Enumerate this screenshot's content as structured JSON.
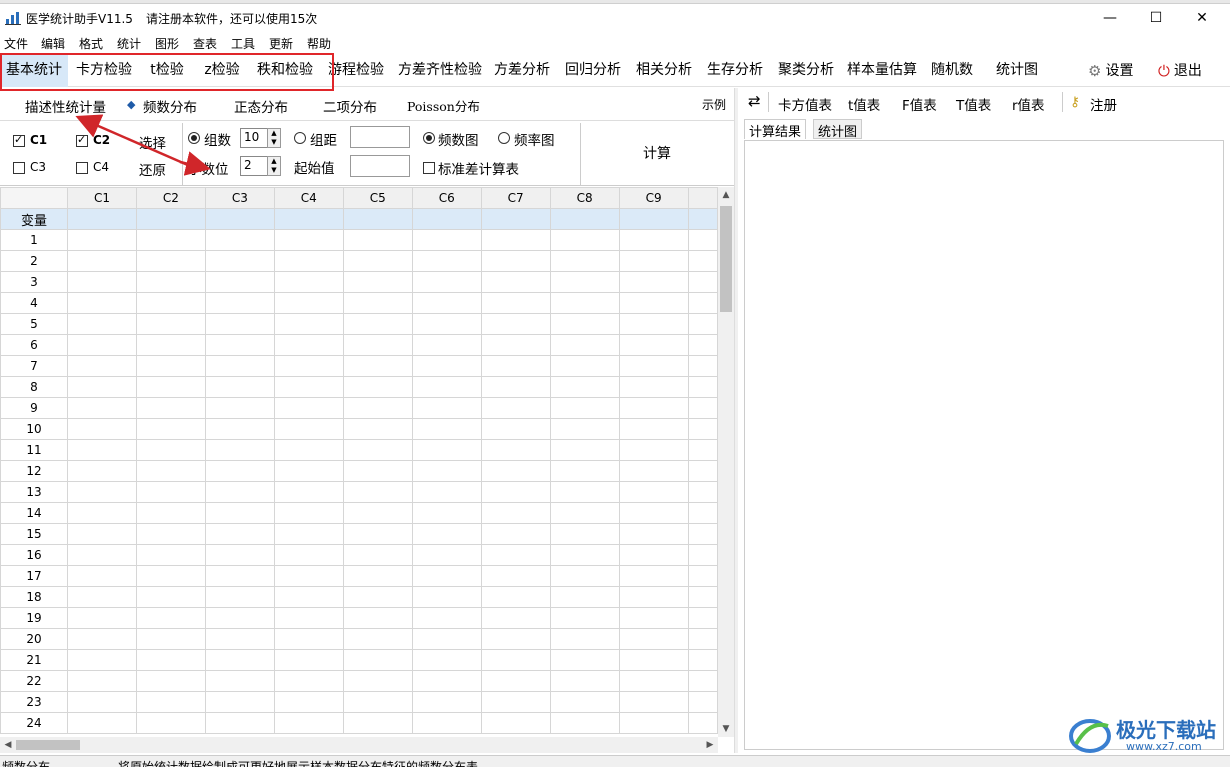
{
  "window": {
    "title": "医学统计助手V11.5",
    "notice": "请注册本软件，还可以使用15次",
    "controls": {
      "minimize": "—",
      "maximize": "☐",
      "close": "✕"
    }
  },
  "menu": [
    "文件",
    "编辑",
    "格式",
    "统计",
    "图形",
    "查表",
    "工具",
    "更新",
    "帮助"
  ],
  "toolbar": {
    "tabs": [
      "基本统计",
      "卡方检验",
      "t检验",
      "z检验",
      "秩和检验",
      "游程检验",
      "方差齐性检验",
      "方差分析",
      "回归分析",
      "相关分析",
      "生存分析",
      "聚类分析",
      "样本量估算",
      "随机数",
      "统计图"
    ],
    "active": "基本统计",
    "settings": "设置",
    "exit": "退出"
  },
  "subtabs": {
    "items": [
      "描述性统计量",
      "频数分布",
      "正态分布",
      "二项分布",
      "Poisson分布"
    ],
    "active": "频数分布",
    "example": "示例"
  },
  "options": {
    "var_c1": "C1",
    "var_c2": "C2",
    "var_c3": "C3",
    "var_c4": "C4",
    "select": "选择",
    "restore": "还原",
    "groups_label": "组数",
    "groups_value": "10",
    "decimals_label": "小数位",
    "decimals_value": "2",
    "interval_label": "组距",
    "start_label": "起始值",
    "freq_chart": "频数图",
    "rate_chart": "频率图",
    "sd_table": "标准差计算表",
    "calculate": "计算"
  },
  "grid": {
    "columns": [
      "C1",
      "C2",
      "C3",
      "C4",
      "C5",
      "C6",
      "C7",
      "C8",
      "C9"
    ],
    "variable_row_label": "变量",
    "rows": [
      "1",
      "2",
      "3",
      "4",
      "5",
      "6",
      "7",
      "8",
      "9",
      "10",
      "11",
      "12",
      "13",
      "14",
      "15",
      "16",
      "17",
      "18",
      "19",
      "20",
      "21",
      "22",
      "23",
      "24"
    ]
  },
  "right_toolbar": [
    "卡方值表",
    "t值表",
    "F值表",
    "T值表",
    "r值表"
  ],
  "register": "注册",
  "result_tabs": [
    "计算结果",
    "统计图"
  ],
  "status": {
    "left": "频数分布",
    "message": "将原始统计数据绘制成可更好地展示样本数据分布特征的频数分布表"
  },
  "watermark": {
    "brand": "极光下载站",
    "url": "www.xz7.com"
  },
  "colors": {
    "highlight": "#e0262a",
    "active_tab": "#d7e8f8",
    "variable_row": "#dbeaf8"
  }
}
